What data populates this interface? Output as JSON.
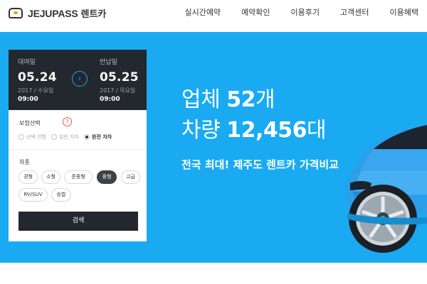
{
  "header": {
    "logo_text": "JEJUPASS",
    "logo_text_ko": "렌트카",
    "nav": [
      "실시간예약",
      "예약확인",
      "이용후기",
      "고객센터",
      "이용혜택"
    ]
  },
  "search_panel": {
    "pickup": {
      "label": "대여일",
      "date": "05.24",
      "sub": "2017 / 수요일",
      "time": "09:00"
    },
    "return": {
      "label": "반납일",
      "date": "05.25",
      "sub": "2017 / 목요일",
      "time": "09:00"
    },
    "arrow": "›",
    "insurance": {
      "title": "보험선택",
      "help": "?",
      "options": [
        {
          "label": "선택 안함",
          "selected": false
        },
        {
          "label": "일반 자차",
          "selected": false
        },
        {
          "label": "완전 자차",
          "selected": true
        }
      ]
    },
    "car_type": {
      "title": "차종",
      "options": [
        {
          "label": "경형",
          "selected": false
        },
        {
          "label": "소형",
          "selected": false
        },
        {
          "label": "준중형",
          "selected": false
        },
        {
          "label": "중형",
          "selected": true
        },
        {
          "label": "고급",
          "selected": false
        },
        {
          "label": "RV/SUV",
          "selected": false
        },
        {
          "label": "승합",
          "selected": false
        }
      ]
    },
    "search_label": "검색"
  },
  "hero": {
    "line1_prefix": "업체 ",
    "line1_value": "52",
    "line1_suffix": "개",
    "line2_prefix": "차량 ",
    "line2_value": "12,456",
    "line2_suffix": "대",
    "subtitle": "전국 최대! 제주도 렌트카 가격비교"
  },
  "colors": {
    "brand_blue": "#1aaaf2",
    "dark_panel": "#23282e",
    "logo_accent": "#f3a21c"
  }
}
